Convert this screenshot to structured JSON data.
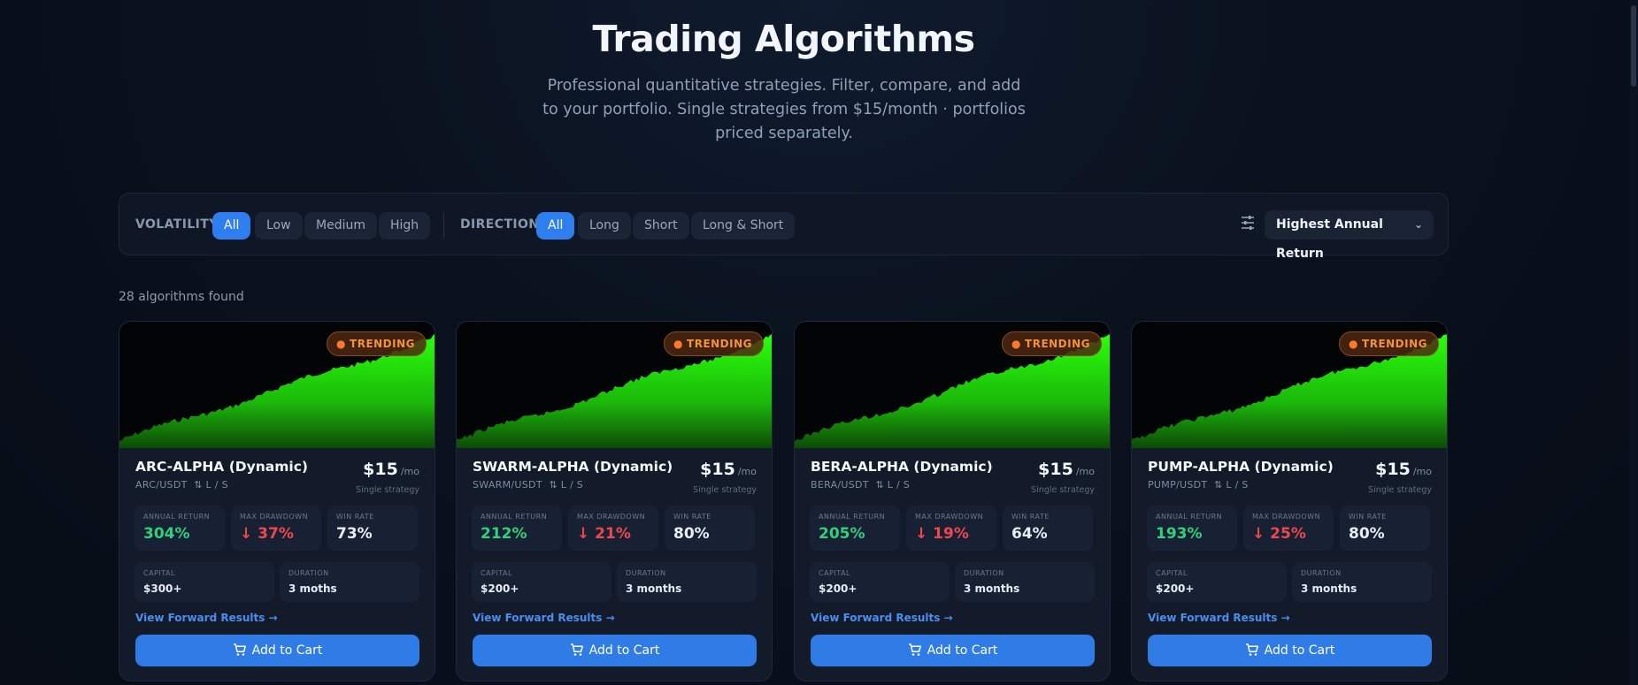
{
  "header": {
    "title": "Trading Algorithms",
    "subtitle": "Professional quantitative strategies. Filter, compare, and add to your portfolio. Single strategies from $15/month · portfolios priced separately."
  },
  "filters": {
    "volatility_label": "VOLATILITY",
    "volatility_options": [
      "All",
      "Low",
      "Medium",
      "High"
    ],
    "volatility_selected": "All",
    "direction_label": "DIRECTION",
    "direction_options": [
      "All",
      "Long",
      "Short",
      "Long & Short"
    ],
    "direction_selected": "All",
    "sort_value": "Highest Annual Return"
  },
  "results": {
    "count_text": "28 algorithms found"
  },
  "labels": {
    "trending": "TRENDING",
    "annual_return": "ANNUAL RETURN",
    "max_drawdown": "MAX DRAWDOWN",
    "win_rate": "WIN RATE",
    "capital": "CAPITAL",
    "duration": "DURATION",
    "price_unit": "/mo",
    "price_sub": "Single strategy",
    "forward_link": "View Forward Results →",
    "add_to_cart": "Add to Cart"
  },
  "cards": [
    {
      "name": "ARC-ALPHA (Dynamic)",
      "pair": "ARC/USDT",
      "direction": "⇅ L / S",
      "price": "$15",
      "annual_return": "304%",
      "max_drawdown": "37%",
      "win_rate": "73%",
      "capital": "$300+",
      "duration": "3 moths"
    },
    {
      "name": "SWARM-ALPHA (Dynamic)",
      "pair": "SWARM/USDT",
      "direction": "⇅ L / S",
      "price": "$15",
      "annual_return": "212%",
      "max_drawdown": "21%",
      "win_rate": "80%",
      "capital": "$200+",
      "duration": "3 months"
    },
    {
      "name": "BERA-ALPHA (Dynamic)",
      "pair": "BERA/USDT",
      "direction": "⇅ L / S",
      "price": "$15",
      "annual_return": "205%",
      "max_drawdown": "19%",
      "win_rate": "64%",
      "capital": "$200+",
      "duration": "3 months"
    },
    {
      "name": "PUMP-ALPHA (Dynamic)",
      "pair": "PUMP/USDT",
      "direction": "⇅ L / S",
      "price": "$15",
      "annual_return": "193%",
      "max_drawdown": "25%",
      "win_rate": "80%",
      "capital": "$200+",
      "duration": "3 months"
    }
  ],
  "colors": {
    "accent": "#2f7ef0",
    "positive": "#2fd27a",
    "negative": "#f0474e",
    "trending": "#f1923f",
    "equity_curve": "#22ff00"
  },
  "icons": {
    "trending": "fire-icon",
    "sort": "sliders-icon",
    "dropdown": "chevron-down-icon",
    "cart": "cart-icon",
    "direction": "arrows-up-down-icon"
  }
}
